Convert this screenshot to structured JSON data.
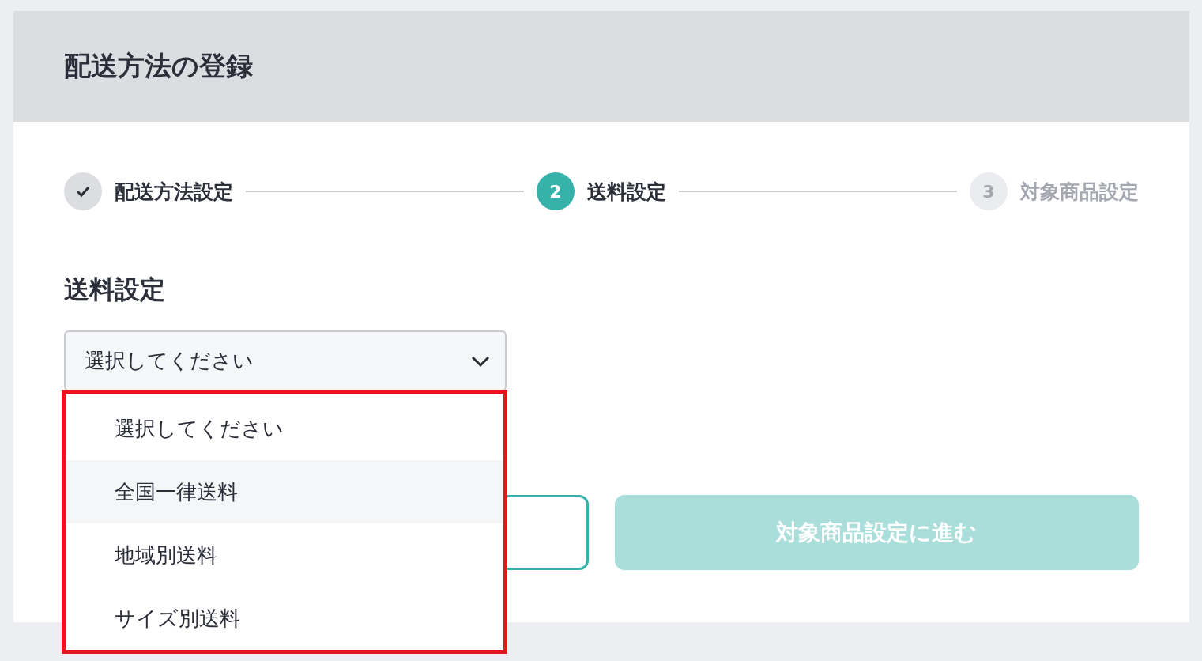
{
  "page_title": "配送方法の登録",
  "steps": [
    {
      "label": "配送方法設定",
      "completed": true,
      "selected": false
    },
    {
      "number": "2",
      "label": "送料設定",
      "completed": false,
      "selected": true
    },
    {
      "number": "3",
      "label": "対象商品設定",
      "completed": false,
      "selected": false
    }
  ],
  "section_title": "送料設定",
  "select": {
    "value": "選択してください",
    "expanded": true,
    "options": [
      {
        "label": "選択してください",
        "hovered": false
      },
      {
        "label": "全国一律送料",
        "hovered": true
      },
      {
        "label": "地域別送料",
        "hovered": false
      },
      {
        "label": "サイズ別送料",
        "hovered": false
      }
    ]
  },
  "buttons": [
    {
      "kind": "outline"
    },
    {
      "kind": "primary",
      "label": "対象商品設定に進む",
      "disabled": true
    }
  ]
}
